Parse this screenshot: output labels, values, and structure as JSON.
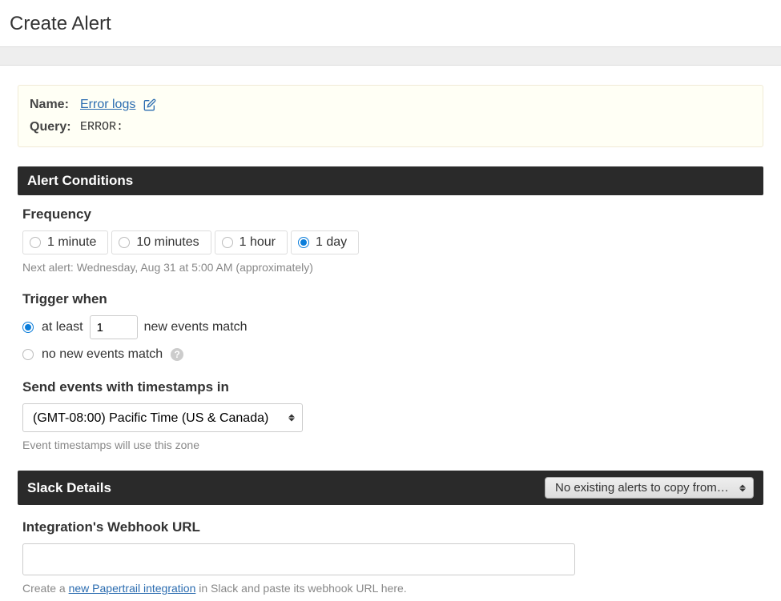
{
  "header": {
    "title": "Create Alert"
  },
  "info": {
    "name_label": "Name:",
    "name_value": "Error logs",
    "query_label": "Query:",
    "query_value": "ERROR:"
  },
  "conditions": {
    "section_title": "Alert Conditions",
    "frequency_label": "Frequency",
    "frequency_options": [
      "1 minute",
      "10 minutes",
      "1 hour",
      "1 day"
    ],
    "frequency_selected_index": 3,
    "next_alert_hint": "Next alert: Wednesday, Aug 31 at 5:00 AM (approximately)",
    "trigger_label": "Trigger when",
    "trigger_at_least_prefix": "at least",
    "trigger_at_least_value": "1",
    "trigger_at_least_suffix": "new events match",
    "trigger_no_new": "no new events match",
    "trigger_selected": "at_least",
    "tz_label": "Send events with timestamps in",
    "tz_value": "(GMT-08:00) Pacific Time (US & Canada)",
    "tz_hint": "Event timestamps will use this zone"
  },
  "slack": {
    "section_title": "Slack Details",
    "copy_from_label": "No existing alerts to copy from…",
    "webhook_label": "Integration's Webhook URL",
    "webhook_value": "",
    "caption_prefix": "Create a ",
    "caption_link": "new Papertrail integration",
    "caption_suffix": " in Slack and paste its webhook URL here."
  }
}
